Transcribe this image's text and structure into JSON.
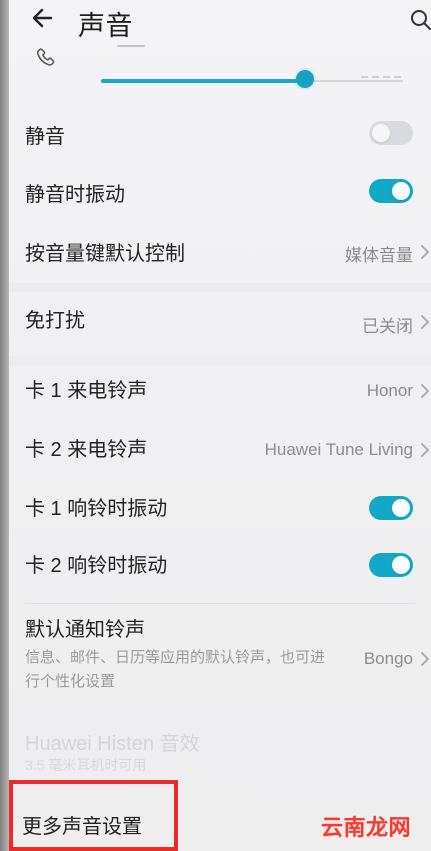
{
  "header": {
    "title": "声音"
  },
  "rows": {
    "mute": {
      "label": "静音",
      "enabled": false
    },
    "vibrate_in_silent": {
      "label": "静音时振动",
      "enabled": true
    },
    "volume_key_default": {
      "label": "按音量键默认控制",
      "value": "媒体音量"
    },
    "do_not_disturb": {
      "label": "免打扰",
      "value": "已关闭"
    },
    "sim1_ringtone": {
      "label": "卡 1 来电铃声",
      "value": "Honor"
    },
    "sim2_ringtone": {
      "label": "卡 2 来电铃声",
      "value": "Huawei Tune Living"
    },
    "sim1_vibrate": {
      "label": "卡 1 响铃时振动",
      "enabled": true
    },
    "sim2_vibrate": {
      "label": "卡 2 响铃时振动",
      "enabled": true
    },
    "default_notification": {
      "label": "默认通知铃声",
      "description": "信息、邮件、日历等应用的默认铃声，也可进行个性化设置",
      "value": "Bongo"
    },
    "faded_item": {
      "label": "Huawei Histen 音效",
      "sub": "3.5 毫米耳机时可用"
    },
    "more_sound_settings": {
      "label": "更多声音设置"
    }
  },
  "volume": {
    "level": 0.81
  },
  "watermark": {
    "text": "云南龙网"
  },
  "colors": {
    "accent": "#12a9c6",
    "highlight": "#ea2b2b",
    "watermark": "#ff2e20"
  }
}
